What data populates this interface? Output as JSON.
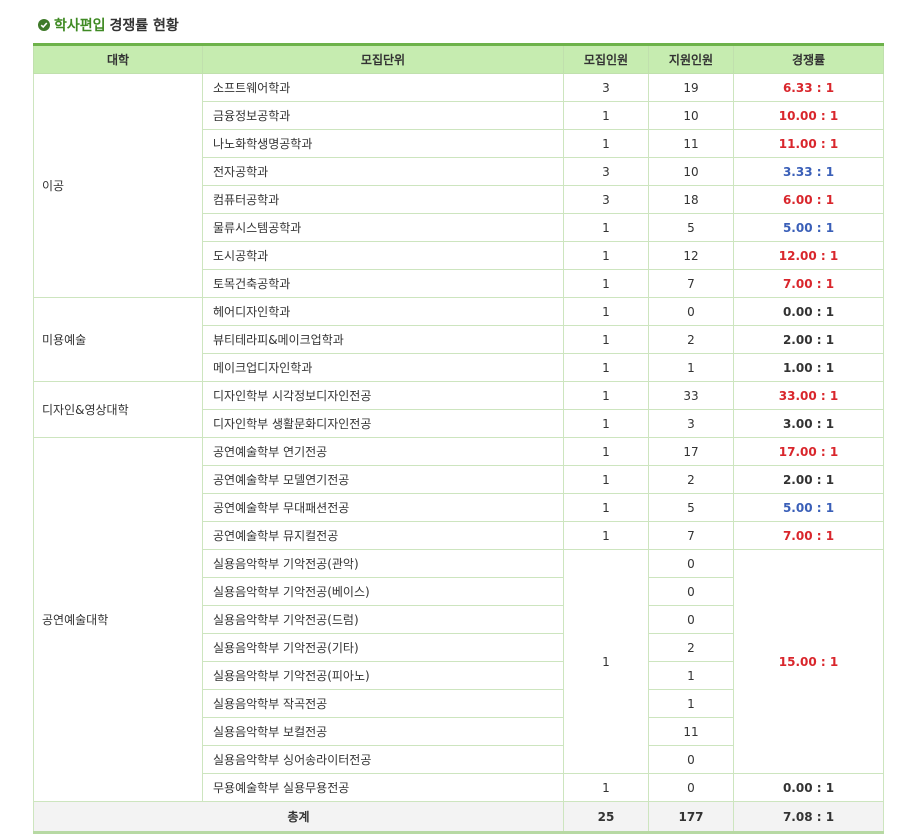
{
  "title": {
    "highlight": "학사편입",
    "rest": "경쟁률 현황"
  },
  "colors": {
    "accent": "#3f8a23",
    "header_bg": "#c6ecb0",
    "high": "#d9262c",
    "low": "#3a5fb8",
    "neutral": "#333333"
  },
  "columns": [
    "대학",
    "모집단위",
    "모집인원",
    "지원인원",
    "경쟁률"
  ],
  "colleges": [
    "이공",
    "미용예술",
    "디자인&영상대학",
    "공연예술대학"
  ],
  "rows": [
    {
      "unit": "소프트웨어학과",
      "quota": "3",
      "applicants": "19",
      "rate": "6.33 : 1",
      "tone": "red"
    },
    {
      "unit": "금융정보공학과",
      "quota": "1",
      "applicants": "10",
      "rate": "10.00 : 1",
      "tone": "red"
    },
    {
      "unit": "나노화학생명공학과",
      "quota": "1",
      "applicants": "11",
      "rate": "11.00 : 1",
      "tone": "red"
    },
    {
      "unit": "전자공학과",
      "quota": "3",
      "applicants": "10",
      "rate": "3.33 : 1",
      "tone": "blue"
    },
    {
      "unit": "컴퓨터공학과",
      "quota": "3",
      "applicants": "18",
      "rate": "6.00 : 1",
      "tone": "red"
    },
    {
      "unit": "물류시스템공학과",
      "quota": "1",
      "applicants": "5",
      "rate": "5.00 : 1",
      "tone": "blue"
    },
    {
      "unit": "도시공학과",
      "quota": "1",
      "applicants": "12",
      "rate": "12.00 : 1",
      "tone": "red"
    },
    {
      "unit": "토목건축공학과",
      "quota": "1",
      "applicants": "7",
      "rate": "7.00 : 1",
      "tone": "red"
    },
    {
      "unit": "헤어디자인학과",
      "quota": "1",
      "applicants": "0",
      "rate": "0.00 : 1",
      "tone": "dark"
    },
    {
      "unit": "뷰티테라피&메이크업학과",
      "quota": "1",
      "applicants": "2",
      "rate": "2.00 : 1",
      "tone": "dark"
    },
    {
      "unit": "메이크업디자인학과",
      "quota": "1",
      "applicants": "1",
      "rate": "1.00 : 1",
      "tone": "dark"
    },
    {
      "unit": "디자인학부 시각정보디자인전공",
      "quota": "1",
      "applicants": "33",
      "rate": "33.00 : 1",
      "tone": "red"
    },
    {
      "unit": "디자인학부 생활문화디자인전공",
      "quota": "1",
      "applicants": "3",
      "rate": "3.00 : 1",
      "tone": "dark"
    },
    {
      "unit": "공연예술학부 연기전공",
      "quota": "1",
      "applicants": "17",
      "rate": "17.00 : 1",
      "tone": "red"
    },
    {
      "unit": "공연예술학부 모델연기전공",
      "quota": "1",
      "applicants": "2",
      "rate": "2.00 : 1",
      "tone": "dark"
    },
    {
      "unit": "공연예술학부 무대패션전공",
      "quota": "1",
      "applicants": "5",
      "rate": "5.00 : 1",
      "tone": "blue"
    },
    {
      "unit": "공연예술학부 뮤지컬전공",
      "quota": "1",
      "applicants": "7",
      "rate": "7.00 : 1",
      "tone": "red"
    },
    {
      "unit": "실용음악학부 기악전공(관악)",
      "applicants": "0"
    },
    {
      "unit": "실용음악학부 기악전공(베이스)",
      "applicants": "0"
    },
    {
      "unit": "실용음악학부 기악전공(드럼)",
      "applicants": "0"
    },
    {
      "unit": "실용음악학부 기악전공(기타)",
      "applicants": "2"
    },
    {
      "unit": "실용음악학부 기악전공(피아노)",
      "applicants": "1"
    },
    {
      "unit": "실용음악학부 작곡전공",
      "applicants": "1"
    },
    {
      "unit": "실용음악학부 보컬전공",
      "applicants": "11"
    },
    {
      "unit": "실용음악학부 싱어송라이터전공",
      "applicants": "0"
    },
    {
      "unit": "무용예술학부 실용무용전공",
      "quota": "1",
      "applicants": "0",
      "rate": "0.00 : 1",
      "tone": "dark"
    }
  ],
  "practical_music_group": {
    "quota": "1",
    "rate": "15.00 : 1",
    "tone": "red"
  },
  "total": {
    "label": "총계",
    "quota": "25",
    "applicants": "177",
    "rate": "7.08 : 1"
  }
}
